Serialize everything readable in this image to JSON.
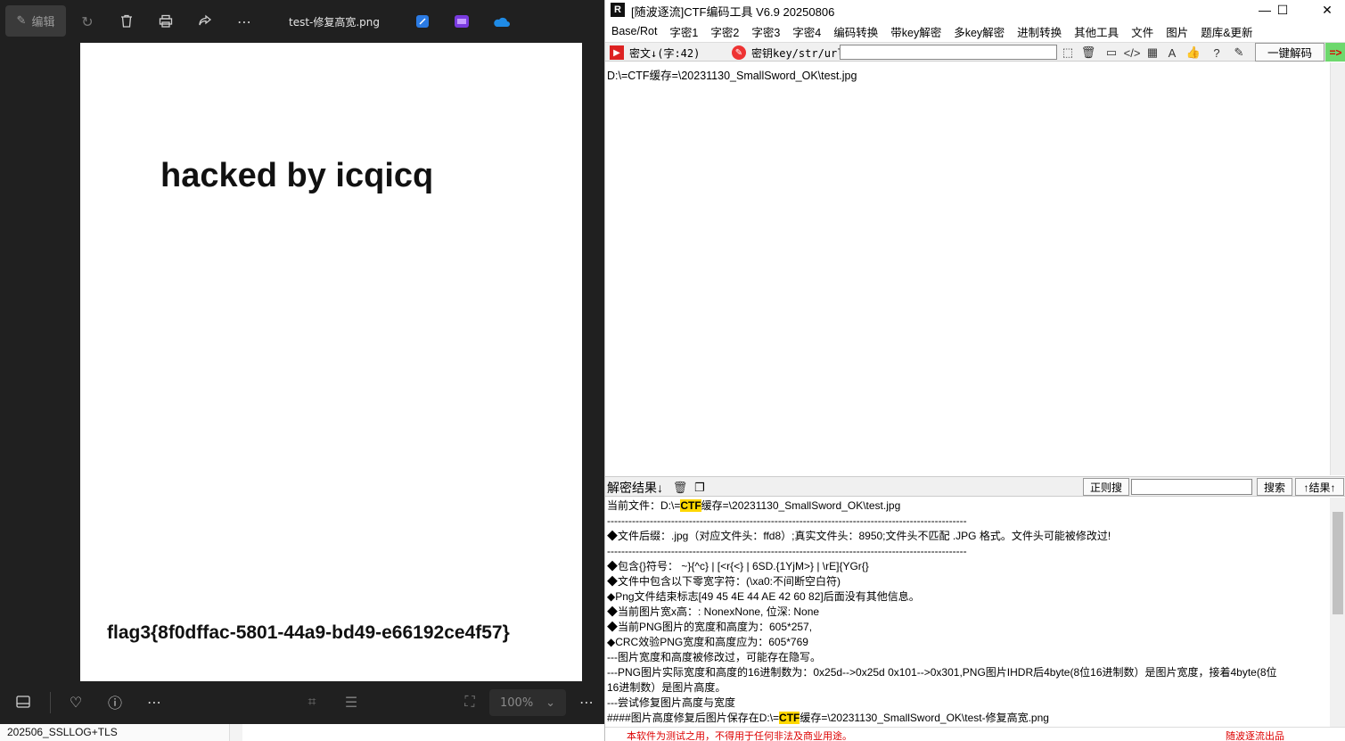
{
  "viewer": {
    "edit_label": "编辑",
    "file_title": "test-修复高宽.png",
    "image_title": "hacked by icqicq",
    "image_flag": "flag3{8f0dffac-5801-44a9-bd49-e66192ce4f57}",
    "zoom": "100%",
    "taskbar_item": "202506_SSLLOG+TLS",
    "icons": [
      "edit-icon",
      "rotate-icon",
      "delete-icon",
      "print-icon",
      "share-icon",
      "more-icon",
      "designer-icon",
      "clipchamp-icon",
      "onedrive-icon",
      "filmstrip-icon",
      "favorite-icon",
      "info-icon",
      "more-icon",
      "visual-search-icon",
      "text-extract-icon",
      "fit-icon",
      "chevron-down-icon",
      "more-icon"
    ]
  },
  "tool": {
    "title": "[随波逐流]CTF编码工具 V6.9  20250806",
    "menus": [
      "Base/Rot",
      "字密1",
      "字密2",
      "字密3",
      "字密4",
      "编码转换",
      "带key解密",
      "多key解密",
      "进制转换",
      "其他工具",
      "文件",
      "图片",
      "题库&更新"
    ],
    "cipher_label": "密文↓(字:42)",
    "key_label": "密钥key/str/url:",
    "key_value": "",
    "decode_button": "一键解码",
    "run_button": "=>",
    "cipher_text": "D:\\=CTF缓存=\\20231130_SmallSword_OK\\test.jpg",
    "result_label": "解密结果↓",
    "regex_button": "正则搜",
    "search_value": "",
    "search_button": "搜索",
    "up_result_button": "↑结果↑",
    "result": {
      "line1_pre": "当前文件：D:\\=",
      "line1_hl": "CTF",
      "line1_post": "缓存=\\20231130_SmallSword_OK\\test.jpg",
      "sep": "-----------------------------------------------------------------------------------------------------",
      "line2": "◆文件后缀：.jpg（对应文件头：ffd8）;真实文件头：8950;文件头不匹配 .JPG 格式。文件头可能被修改过!",
      "line3": "◆包含{}符号： ~}{^c} | [<r{<} | 6SD.{1YjM>} | \\rE]{YGr{}",
      "line4": "◆文件中包含以下零宽字符：(\\xa0:不间断空白符)",
      "line5": "◆Png文件结束标志[49 45 4E 44 AE 42 60 82]后面没有其他信息。",
      "line6": "◆当前图片宽x高：: NonexNone, 位深: None",
      "line7": "◆当前PNG图片的宽度和高度为：605*257,",
      "line8": "◆CRC效验PNG宽度和高度应为：605*769",
      "line9": "---图片宽度和高度被修改过，可能存在隐写。",
      "line10": "---PNG图片实际宽度和高度的16进制数为：0x25d-->0x25d 0x101-->0x301,PNG图片IHDR后4byte(8位16进制数）是图片宽度，接着4byte(8位",
      "line11": "16进制数）是图片高度。",
      "line12": "---尝试修复图片高度与宽度",
      "line13_pre": "####图片高度修复后图片保存在D:\\=",
      "line13_hl": "CTF",
      "line13_post": "缓存=\\20231130_SmallSword_OK\\test-修复高宽.png"
    },
    "status_left": "本软件为测试之用，不得用于任何非法及商业用途。",
    "status_right": "随波逐流出品"
  }
}
